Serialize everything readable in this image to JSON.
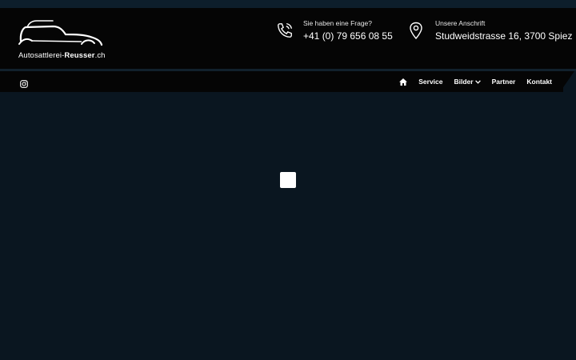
{
  "header": {
    "logo": {
      "text_regular": "Autosattlerei-",
      "text_bold": "Reusser",
      "text_suffix": ".ch"
    },
    "phone": {
      "label": "Sie haben eine Frage?",
      "value": "+41 (0) 79 656 08 55",
      "icon": "phone-icon"
    },
    "address": {
      "label": "Unsere Anschrift",
      "value": "Studweidstrasse 16, 3700 Spiez",
      "icon": "map-pin-icon"
    }
  },
  "nav": {
    "social_icon": "instagram-icon",
    "home_icon": "home-icon",
    "items": [
      {
        "label": "Service"
      },
      {
        "label": "Bilder",
        "has_dropdown": true
      },
      {
        "label": "Partner"
      },
      {
        "label": "Kontakt"
      }
    ]
  },
  "colors": {
    "page_background": "#0a1620",
    "header_background": "#050505",
    "text": "#ffffff"
  }
}
